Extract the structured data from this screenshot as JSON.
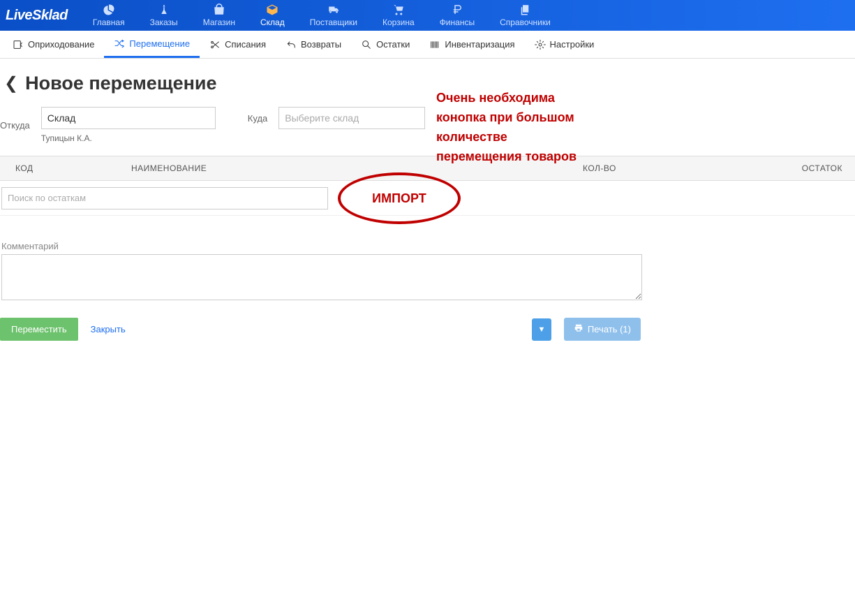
{
  "logo": "LiveSklad",
  "top_nav": [
    {
      "label": "Главная",
      "name": "nav-home",
      "icon": "pie"
    },
    {
      "label": "Заказы",
      "name": "nav-orders",
      "icon": "tool"
    },
    {
      "label": "Магазин",
      "name": "nav-shop",
      "icon": "bag"
    },
    {
      "label": "Склад",
      "name": "nav-warehouse",
      "icon": "box",
      "active": true
    },
    {
      "label": "Поставщики",
      "name": "nav-suppliers",
      "icon": "truck"
    },
    {
      "label": "Корзина",
      "name": "nav-cart",
      "icon": "cart"
    },
    {
      "label": "Финансы",
      "name": "nav-finance",
      "icon": "ruble"
    },
    {
      "label": "Справочники",
      "name": "nav-refs",
      "icon": "copy"
    }
  ],
  "tabs": [
    {
      "label": "Оприходование",
      "name": "tab-incoming",
      "icon": "in"
    },
    {
      "label": "Перемещение",
      "name": "tab-transfer",
      "icon": "shuffle",
      "active": true
    },
    {
      "label": "Списания",
      "name": "tab-writeoff",
      "icon": "cut"
    },
    {
      "label": "Возвраты",
      "name": "tab-returns",
      "icon": "undo"
    },
    {
      "label": "Остатки",
      "name": "tab-stock",
      "icon": "search"
    },
    {
      "label": "Инвентаризация",
      "name": "tab-inventory",
      "icon": "barcode"
    },
    {
      "label": "Настройки",
      "name": "tab-settings",
      "icon": "gear"
    }
  ],
  "page_title": "Новое перемещение",
  "from_label": "Откуда",
  "from_value": "Склад",
  "from_user": "Тупицын К.А.",
  "to_label": "Куда",
  "to_placeholder": "Выберите склад",
  "annotation_text": "Очень необходима конопка при большом количестве перемещения товаров",
  "table": {
    "code": "КОД",
    "name": "НАИМЕНОВАНИЕ",
    "qty": "КОЛ-ВО",
    "stock": "ОСТАТОК"
  },
  "search_placeholder": "Поиск по остаткам",
  "import_label": "ИМПОРТ",
  "comment_label": "Комментарий",
  "btn_move": "Переместить",
  "btn_close": "Закрыть",
  "btn_print": "Печать (1)"
}
